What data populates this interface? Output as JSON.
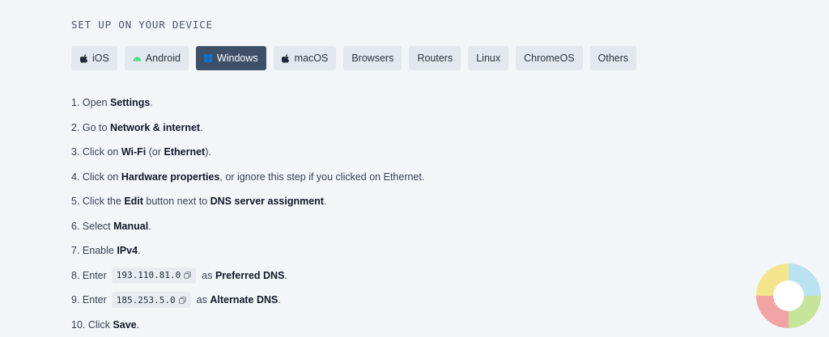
{
  "header": {
    "title": "SET UP ON YOUR DEVICE"
  },
  "tabs": [
    {
      "label": "iOS",
      "icon": "apple-icon",
      "active": false
    },
    {
      "label": "Android",
      "icon": "android-icon",
      "active": false
    },
    {
      "label": "Windows",
      "icon": "windows-icon",
      "active": true
    },
    {
      "label": "macOS",
      "icon": "apple-icon",
      "active": false
    },
    {
      "label": "Browsers",
      "icon": "",
      "active": false
    },
    {
      "label": "Routers",
      "icon": "",
      "active": false
    },
    {
      "label": "Linux",
      "icon": "",
      "active": false
    },
    {
      "label": "ChromeOS",
      "icon": "",
      "active": false
    },
    {
      "label": "Others",
      "icon": "",
      "active": false
    }
  ],
  "steps": {
    "s1": {
      "num": "1.",
      "pre": "Open",
      "b1": "Settings",
      "post": "."
    },
    "s2": {
      "num": "2.",
      "pre": "Go to",
      "b1": "Network & internet",
      "post": "."
    },
    "s3": {
      "num": "3.",
      "pre": "Click on",
      "b1": "Wi-Fi",
      "mid": "(or",
      "b2": "Ethernet",
      "post": ")."
    },
    "s4": {
      "num": "4.",
      "pre": "Click on",
      "b1": "Hardware properties",
      "post": ", or ignore this step if you clicked on Ethernet."
    },
    "s5": {
      "num": "5.",
      "pre": "Click the",
      "b1": "Edit",
      "mid": "button next to",
      "b2": "DNS server assignment",
      "post": "."
    },
    "s6": {
      "num": "6.",
      "pre": "Select",
      "b1": "Manual",
      "post": "."
    },
    "s7": {
      "num": "7.",
      "pre": "Enable",
      "b1": "IPv4",
      "post": "."
    },
    "s8": {
      "num": "8.",
      "pre": "Enter",
      "code": "193.110.81.0",
      "mid": "as",
      "b1": "Preferred DNS",
      "post": "."
    },
    "s9": {
      "num": "9.",
      "pre": "Enter",
      "code": "185.253.5.0",
      "mid": "as",
      "b1": "Alternate DNS",
      "post": "."
    },
    "s10": {
      "num": "10.",
      "pre": "Click",
      "b1": "Save",
      "post": "."
    }
  },
  "colors": {
    "background": "#f3f6f9",
    "tab_bg": "#e3e8ee",
    "tab_active_bg": "#3e5068",
    "android_green": "#3ddc84",
    "windows_blue": "#0a74d6",
    "code_bg": "#e8ecf0"
  }
}
